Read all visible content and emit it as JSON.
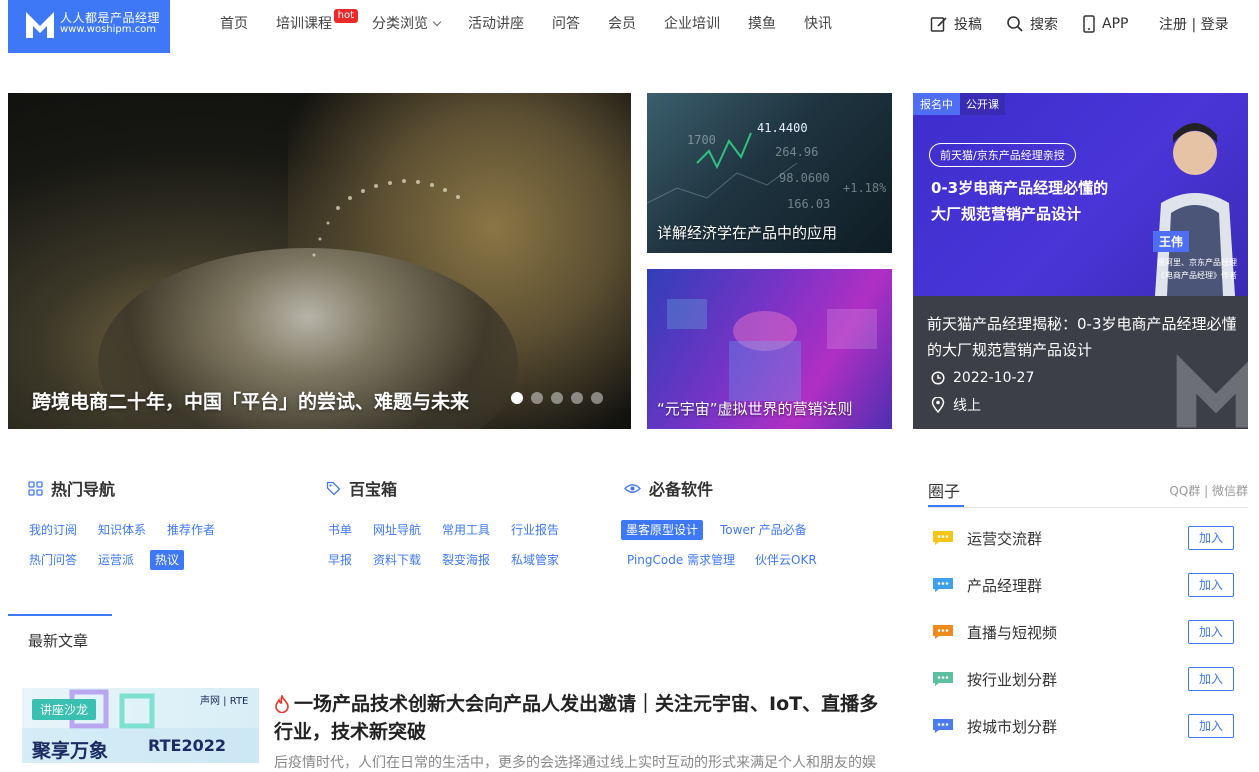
{
  "logo": {
    "line1": "人人都是产品经理",
    "line2": "www.woshipm.com"
  },
  "nav": [
    {
      "label": "首页"
    },
    {
      "label": "培训课程",
      "badge": "hot"
    },
    {
      "label": "分类浏览",
      "dropdown": true
    },
    {
      "label": "活动讲座"
    },
    {
      "label": "问答"
    },
    {
      "label": "会员"
    },
    {
      "label": "企业培训"
    },
    {
      "label": "摸鱼"
    },
    {
      "label": "快讯"
    }
  ],
  "tools": {
    "post": "投稿",
    "search": "搜索",
    "app": "APP"
  },
  "auth": {
    "register": "注册",
    "sep": "|",
    "login": "登录"
  },
  "hero": {
    "main_title": "跨境电商二十年，中国「平台」的尝试、难题与未来",
    "slide_count": 5,
    "active_slide": 1,
    "side1_title": "详解经济学在产品中的应用",
    "side2_title": "“元宇宙”虚拟世界的营销法则",
    "side1_numbers": [
      "1700",
      "41.4400",
      "264.96",
      "98.0600",
      "+1.18%",
      "166.03"
    ]
  },
  "course": {
    "badge_status": "报名中",
    "badge_type": "公开课",
    "pill": "前天猫/京东产品经理亲授",
    "headline1": "0-3岁电商产品经理必懂的",
    "headline2": "大厂规范营销产品设计",
    "speaker": "王伟",
    "role1": "原阿里、京东产品经理",
    "role2": "《电商产品经理》作者",
    "title": "前天猫产品经理揭秘：0-3岁电商产品经理必懂的大厂规范营销产品设计",
    "date": "2022-10-27",
    "location": "线上"
  },
  "sections": {
    "hot_nav": {
      "title": "热门导航",
      "tags": [
        "我的订阅",
        "知识体系",
        "推荐作者",
        "热门问答",
        "运营派",
        "热议"
      ],
      "highlight": "热议"
    },
    "toolbox": {
      "title": "百宝箱",
      "tags": [
        "书单",
        "网址导航",
        "常用工具",
        "行业报告",
        "早报",
        "资料下载",
        "裂变海报",
        "私域管家"
      ]
    },
    "software": {
      "title": "必备软件",
      "tags": [
        "墨客原型设计",
        "Tower 产品必备",
        "PingCode 需求管理",
        "伙伴云OKR"
      ],
      "highlight": "墨客原型设计"
    }
  },
  "latest": {
    "title": "最新文章"
  },
  "article": {
    "image_tag": "讲座沙龙",
    "image_text": "聚享万象",
    "image_rte": "RTE2022",
    "image_logo": "声网 | RTE",
    "heading": "一场产品技术创新大会向产品人发出邀请｜关注元宇宙、IoT、直播多行业，技术新突破",
    "summary": "后疫情时代，人们在日常的生活中，更多的会选择通过线上实时互动的形式来满足个人和朋友的娱"
  },
  "circle": {
    "title": "圈子",
    "links": "QQ群 | 微信群",
    "join_label": "加入",
    "groups": [
      {
        "label": "运营交流群",
        "color": "#f5c518"
      },
      {
        "label": "产品经理群",
        "color": "#3fa0f0"
      },
      {
        "label": "直播与短视频",
        "color": "#f08a1c"
      },
      {
        "label": "按行业划分群",
        "color": "#5cc0a0"
      },
      {
        "label": "按城市划分群",
        "color": "#4a7cf0"
      }
    ]
  },
  "colors": {
    "accent": "#3f78f6",
    "hot": "#ea2a2a"
  }
}
